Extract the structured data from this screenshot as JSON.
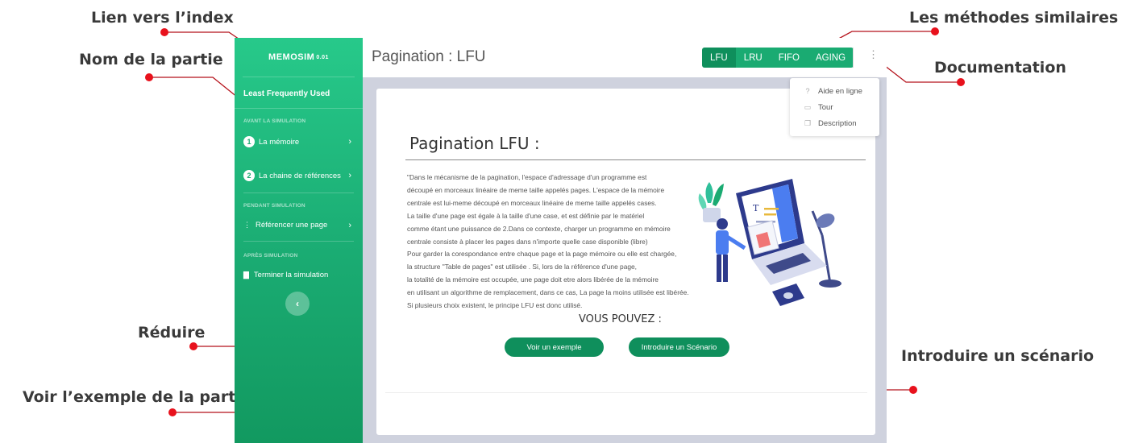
{
  "callouts": {
    "index_link": "Lien vers l’index",
    "part_name": "Nom de la partie",
    "reduce": "Réduire",
    "see_example": "Voir l’exemple de la partie",
    "similar_methods": "Les méthodes similaires",
    "documentation": "Documentation",
    "introduce_scenario": "Introduire un scénario"
  },
  "sidebar": {
    "brand": "MEMOSIM",
    "version": "0.01",
    "part_name": "Least Frequently Used",
    "sections": [
      {
        "label": "AVANT LA SIMULATION",
        "items": [
          {
            "num": "1",
            "label": "La mémoire"
          },
          {
            "num": "2",
            "label": "La chaine de références"
          }
        ]
      },
      {
        "label": "PENDANT SIMULATION",
        "items": [
          {
            "label": "Référencer une page"
          }
        ]
      },
      {
        "label": "APRÈS SIMULATION",
        "items": [
          {
            "label": "Terminer la simulation"
          }
        ]
      }
    ],
    "collapse_icon": "chevron-left-icon"
  },
  "header": {
    "title": "Pagination : LFU",
    "methods": [
      "LFU",
      "LRU",
      "FIFO",
      "AGING"
    ],
    "active_method": "LFU"
  },
  "dropdown": {
    "items": [
      {
        "icon": "help-circle-icon",
        "label": "Aide en ligne"
      },
      {
        "icon": "film-icon",
        "label": "Tour"
      },
      {
        "icon": "copy-icon",
        "label": "Description"
      }
    ]
  },
  "content": {
    "title": "Pagination LFU :",
    "description_lines": [
      "\"Dans le mécanisme de la pagination, l'espace d'adressage d'un programme est",
      "découpé en morceaux linéaire de meme taille appelés pages. L'espace de la mémoire",
      "centrale est lui-meme découpé en morceaux linéaire de meme taille appelés cases.",
      "La taille d'une page est égale à la taille d'une case, et est définie par le matériel",
      "comme étant une puissance de 2.Dans ce contexte, charger un programme en mémoire",
      "centrale consiste à placer les pages dans n'importe quelle case disponible (libre)",
      "Pour garder la corespondance entre chaque page et la page mémoire ou elle est chargée,",
      "la structure \"Table de pages\" est utilisée . Si, lors de la référence d'une page,",
      "la totalité de la mémoire est occupée, une page doit etre alors libérée de la mémoire",
      "en utilisant un algorithme de remplacement, dans ce cas, La page la moins utilisée est libérée.",
      "Si plusieurs choix existent, le principe LFU est donc utilisé."
    ],
    "prompt": "VOUS POUVEZ :",
    "example_button": "Voir un exemple",
    "scenario_button": "Introduire un Scénario"
  },
  "colors": {
    "accent": "#1aab72",
    "accent_dark": "#0f8f5c",
    "callout_dot": "#e8111c",
    "main_bg": "#cfd2de"
  }
}
